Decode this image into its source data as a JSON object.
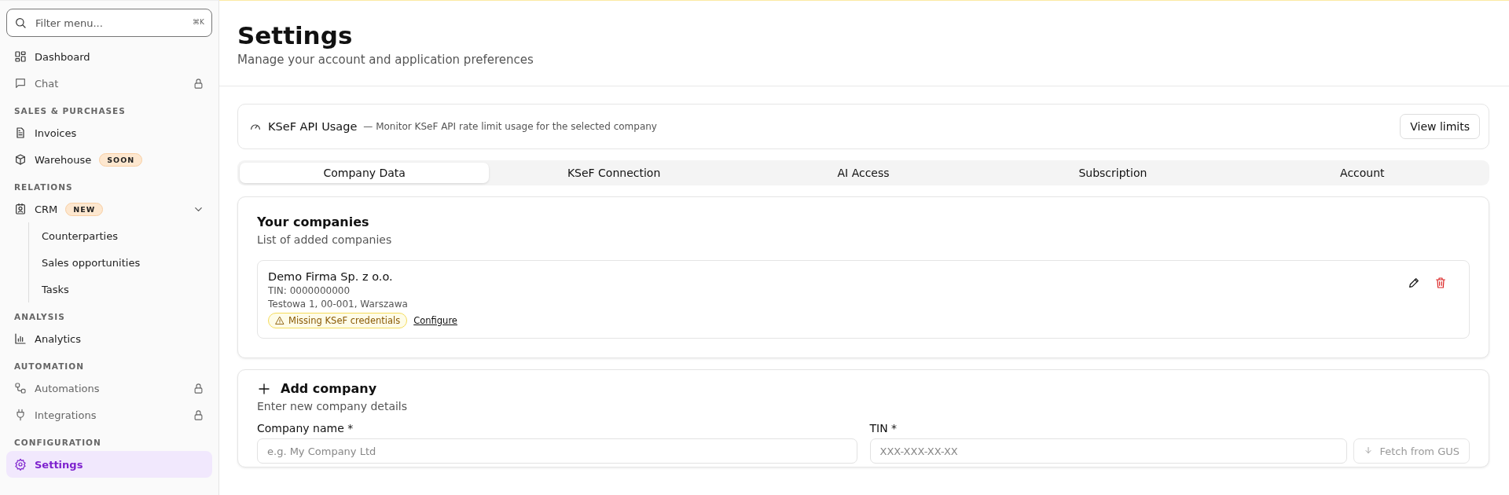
{
  "sidebar": {
    "search": {
      "placeholder": "Filter menu...",
      "shortcut": "⌘K"
    },
    "sections": [
      {
        "items": [
          {
            "label": "Dashboard",
            "locked": false,
            "selected": false
          },
          {
            "label": "Chat",
            "locked": true,
            "selected": false
          }
        ]
      },
      {
        "heading": "SALES & PURCHASES",
        "items": [
          {
            "label": "Invoices",
            "locked": false,
            "selected": false
          },
          {
            "label": "Warehouse",
            "badge": "SOON",
            "locked": false,
            "selected": false
          }
        ]
      },
      {
        "heading": "RELATIONS",
        "items": [
          {
            "label": "CRM",
            "badge": "NEW",
            "locked": false,
            "selected": false,
            "expanded": true,
            "children": [
              {
                "label": "Counterparties",
                "selected": false
              },
              {
                "label": "Sales opportunities",
                "selected": false
              },
              {
                "label": "Tasks",
                "selected": false
              }
            ]
          }
        ]
      },
      {
        "heading": "ANALYSIS",
        "items": [
          {
            "label": "Analytics",
            "locked": false,
            "selected": false
          }
        ]
      },
      {
        "heading": "AUTOMATION",
        "items": [
          {
            "label": "Automations",
            "locked": true,
            "selected": false
          },
          {
            "label": "Integrations",
            "locked": true,
            "selected": false
          }
        ]
      },
      {
        "heading": "CONFIGURATION",
        "items": [
          {
            "label": "Settings",
            "locked": false,
            "selected": true
          }
        ]
      }
    ]
  },
  "header": {
    "title": "Settings",
    "subtitle": "Manage your account and application preferences"
  },
  "usage": {
    "title": "KSeF API Usage",
    "description": "— Monitor KSeF API rate limit usage for the selected company",
    "button": "View limits"
  },
  "tabs": [
    {
      "label": "Company Data",
      "selected": true
    },
    {
      "label": "KSeF Connection",
      "selected": false
    },
    {
      "label": "AI Access",
      "selected": false
    },
    {
      "label": "Subscription",
      "selected": false
    },
    {
      "label": "Account",
      "selected": false
    }
  ],
  "companies": {
    "title": "Your companies",
    "subtitle": "List of added companies",
    "items": [
      {
        "name": "Demo Firma Sp. z o.o.",
        "tin": "TIN: 0000000000",
        "address": "Testowa 1, 00-001, Warszawa",
        "warning": "Missing KSeF credentials",
        "link": "Configure"
      }
    ]
  },
  "add_company": {
    "title": "Add company",
    "subtitle": "Enter new company details",
    "fields": [
      {
        "label": "Company name *",
        "placeholder": "e.g. My Company Ltd"
      },
      {
        "label": "TIN *",
        "placeholder": "XXX-XXX-XX-XX"
      }
    ],
    "fetch_button": "Fetch from GUS"
  }
}
